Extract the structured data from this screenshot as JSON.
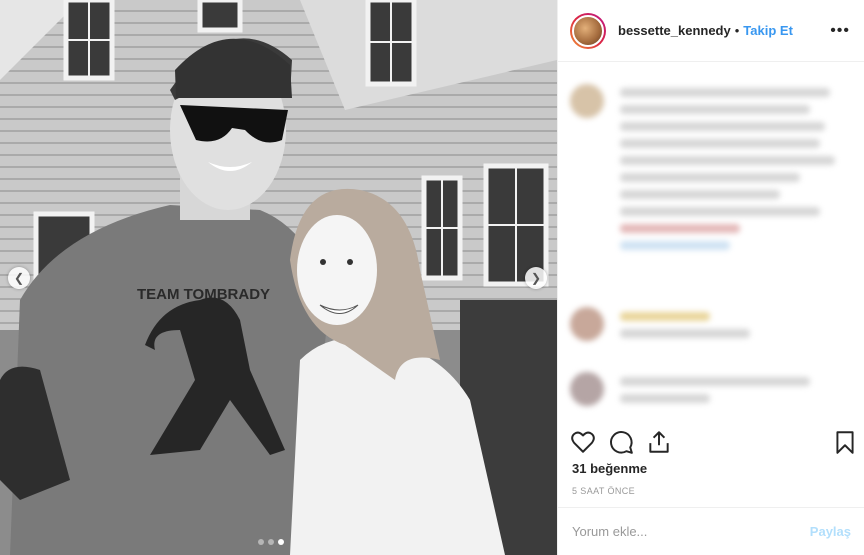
{
  "post": {
    "username": "bessette_kennedy",
    "separator": "•",
    "follow_label": "Takip Et",
    "more_label": "•••",
    "likes_text": "31 beğenme",
    "time_text": "5 SAAT ÖNCE",
    "comment_placeholder": "Yorum ekle...",
    "share_label": "Paylaş"
  },
  "photo": {
    "shirt_text": "TEAM TOMBRADY",
    "carousel_count": 3,
    "carousel_active": 3
  },
  "colors": {
    "link": "#3897f0",
    "share_disabled": "#b2dffc",
    "text": "#262626",
    "muted": "#999999"
  },
  "icons": [
    "heart-icon",
    "comment-icon",
    "share-icon",
    "bookmark-icon",
    "chevron-left-icon",
    "chevron-right-icon",
    "more-icon"
  ]
}
